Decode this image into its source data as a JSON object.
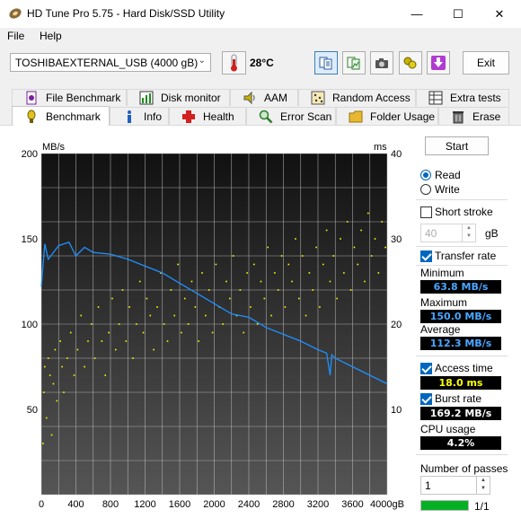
{
  "window": {
    "title": "HD Tune Pro 5.75 - Hard Disk/SSD Utility",
    "minimize": "—",
    "maximize": "☐",
    "close": "✕"
  },
  "menu": [
    {
      "label": "File"
    },
    {
      "label": "Help"
    }
  ],
  "toolbar": {
    "drive": "TOSHIBAEXTERNAL_USB (4000 gB)",
    "temperature": "28°C",
    "exit_label": "Exit"
  },
  "tabs_row1": [
    {
      "label": "File Benchmark",
      "icon": "file-benchmark-icon"
    },
    {
      "label": "Disk monitor",
      "icon": "disk-monitor-icon"
    },
    {
      "label": "AAM",
      "icon": "speaker-icon"
    },
    {
      "label": "Random Access",
      "icon": "random-access-icon"
    },
    {
      "label": "Extra tests",
      "icon": "extra-tests-icon"
    }
  ],
  "tabs_row2": [
    {
      "label": "Benchmark",
      "icon": "benchmark-icon",
      "active": true
    },
    {
      "label": "Info",
      "icon": "info-icon"
    },
    {
      "label": "Health",
      "icon": "health-icon"
    },
    {
      "label": "Error Scan",
      "icon": "error-scan-icon"
    },
    {
      "label": "Folder Usage",
      "icon": "folder-icon"
    },
    {
      "label": "Erase",
      "icon": "erase-icon"
    }
  ],
  "controls": {
    "start_label": "Start",
    "read_label": "Read",
    "read_selected": true,
    "write_label": "Write",
    "short_stroke_label": "Short stroke",
    "short_stroke_checked": false,
    "short_stroke_value": "40",
    "short_stroke_unit": "gB",
    "transfer_rate_label": "Transfer rate",
    "transfer_rate_checked": true,
    "access_time_label": "Access time",
    "access_time_checked": true,
    "burst_rate_label": "Burst rate",
    "burst_rate_checked": true,
    "passes_label": "Number of passes",
    "passes_value": "1",
    "pass_progress_text": "1/1",
    "pass_progress": 1.0
  },
  "results": {
    "minimum_label": "Minimum",
    "minimum": "63.8 MB/s",
    "maximum_label": "Maximum",
    "maximum": "150.0 MB/s",
    "average_label": "Average",
    "average": "112.3 MB/s",
    "access_time": "18.0 ms",
    "burst_rate": "169.2 MB/s",
    "cpu_label": "CPU usage",
    "cpu": "4.2%"
  },
  "colors": {
    "transfer_line": "#1e90ff",
    "access_dots": "#ffff00",
    "readout_blue": "#4aa6ff",
    "readout_yellow": "#ffff00",
    "readout_white": "#ffffff",
    "accent": "#0067c0"
  },
  "chart_data": {
    "type": "line",
    "ylabel_left": "MB/s",
    "ylabel_right": "ms",
    "y_left_ticks": [
      "200",
      "150",
      "100",
      "50"
    ],
    "y_right_ticks": [
      "40",
      "30",
      "20",
      "10"
    ],
    "x_ticks": [
      "0",
      "400",
      "800",
      "1200",
      "1600",
      "2000",
      "2400",
      "2800",
      "3200",
      "3600",
      "4000gB"
    ],
    "xlim": [
      0,
      4000
    ],
    "ylim_left": [
      0,
      200
    ],
    "ylim_right": [
      0,
      40
    ],
    "grid": true,
    "series": [
      {
        "type": "line",
        "x": [
          0,
          40,
          80,
          200,
          320,
          400,
          500,
          600,
          800,
          1000,
          1200,
          1400,
          1600,
          1800,
          2000,
          2200,
          2400,
          2600,
          2800,
          3000,
          3200,
          3300,
          3340,
          3360,
          3400,
          3600,
          3800,
          4000
        ],
        "values": [
          122,
          147,
          138,
          146,
          148,
          140,
          145,
          142,
          141,
          138,
          134,
          130,
          124,
          118,
          112,
          106,
          104,
          98,
          94,
          90,
          85,
          83,
          70,
          82,
          80,
          75,
          70,
          65
        ]
      },
      {
        "type": "scatter",
        "y_axis": "right",
        "points": [
          [
            20,
            6
          ],
          [
            30,
            12
          ],
          [
            40,
            15
          ],
          [
            60,
            9
          ],
          [
            80,
            16
          ],
          [
            100,
            14
          ],
          [
            120,
            7
          ],
          [
            140,
            13
          ],
          [
            160,
            17
          ],
          [
            180,
            11
          ],
          [
            220,
            18
          ],
          [
            240,
            15
          ],
          [
            260,
            12
          ],
          [
            300,
            16
          ],
          [
            340,
            19
          ],
          [
            380,
            14
          ],
          [
            420,
            17
          ],
          [
            460,
            21
          ],
          [
            500,
            15
          ],
          [
            540,
            18
          ],
          [
            580,
            20
          ],
          [
            620,
            16
          ],
          [
            660,
            22
          ],
          [
            700,
            18
          ],
          [
            740,
            14
          ],
          [
            780,
            19
          ],
          [
            820,
            23
          ],
          [
            860,
            17
          ],
          [
            900,
            20
          ],
          [
            940,
            24
          ],
          [
            980,
            18
          ],
          [
            1020,
            22
          ],
          [
            1060,
            16
          ],
          [
            1100,
            20
          ],
          [
            1140,
            25
          ],
          [
            1180,
            19
          ],
          [
            1220,
            23
          ],
          [
            1260,
            21
          ],
          [
            1300,
            17
          ],
          [
            1340,
            22
          ],
          [
            1380,
            26
          ],
          [
            1420,
            20
          ],
          [
            1460,
            18
          ],
          [
            1500,
            24
          ],
          [
            1540,
            21
          ],
          [
            1580,
            27
          ],
          [
            1620,
            19
          ],
          [
            1660,
            23
          ],
          [
            1700,
            20
          ],
          [
            1740,
            25
          ],
          [
            1780,
            22
          ],
          [
            1820,
            18
          ],
          [
            1860,
            26
          ],
          [
            1900,
            21
          ],
          [
            1940,
            24
          ],
          [
            1980,
            19
          ],
          [
            2020,
            27
          ],
          [
            2060,
            22
          ],
          [
            2100,
            20
          ],
          [
            2140,
            25
          ],
          [
            2180,
            23
          ],
          [
            2220,
            28
          ],
          [
            2260,
            21
          ],
          [
            2300,
            24
          ],
          [
            2340,
            19
          ],
          [
            2380,
            26
          ],
          [
            2420,
            22
          ],
          [
            2460,
            27
          ],
          [
            2500,
            20
          ],
          [
            2540,
            25
          ],
          [
            2580,
            23
          ],
          [
            2620,
            29
          ],
          [
            2660,
            21
          ],
          [
            2700,
            26
          ],
          [
            2740,
            24
          ],
          [
            2780,
            28
          ],
          [
            2820,
            22
          ],
          [
            2860,
            27
          ],
          [
            2900,
            25
          ],
          [
            2940,
            30
          ],
          [
            2980,
            23
          ],
          [
            3020,
            28
          ],
          [
            3060,
            21
          ],
          [
            3100,
            26
          ],
          [
            3140,
            24
          ],
          [
            3180,
            29
          ],
          [
            3220,
            22
          ],
          [
            3260,
            27
          ],
          [
            3300,
            31
          ],
          [
            3340,
            25
          ],
          [
            3380,
            28
          ],
          [
            3420,
            23
          ],
          [
            3460,
            30
          ],
          [
            3500,
            26
          ],
          [
            3540,
            32
          ],
          [
            3580,
            24
          ],
          [
            3620,
            29
          ],
          [
            3660,
            27
          ],
          [
            3700,
            31
          ],
          [
            3740,
            25
          ],
          [
            3780,
            33
          ],
          [
            3820,
            28
          ],
          [
            3860,
            30
          ],
          [
            3900,
            26
          ],
          [
            3940,
            32
          ],
          [
            3980,
            29
          ]
        ]
      }
    ]
  }
}
